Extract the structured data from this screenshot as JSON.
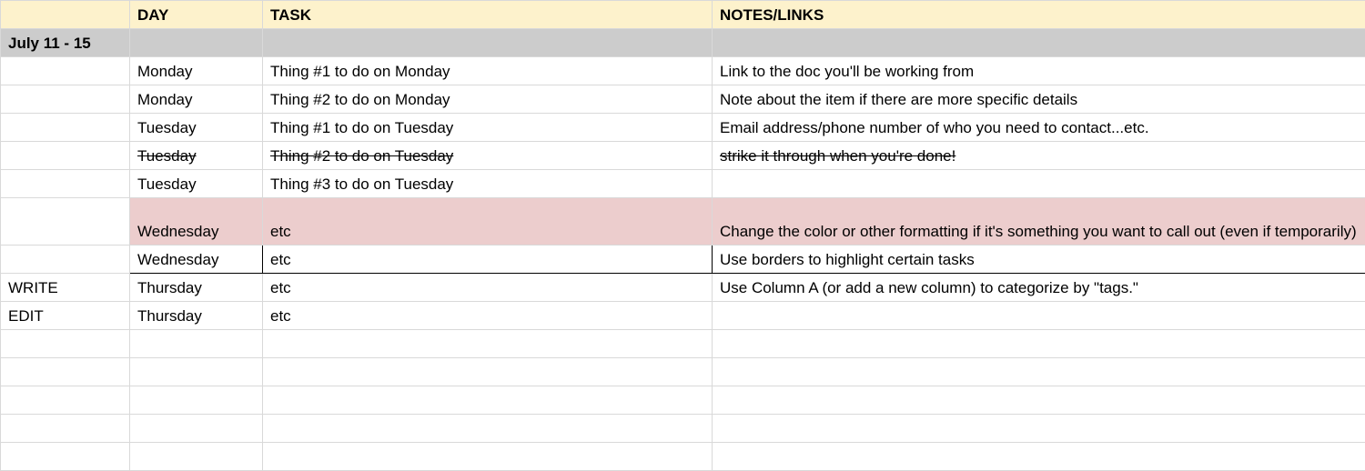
{
  "headers": {
    "a": "",
    "day": "DAY",
    "task": "TASK",
    "notes": "NOTES/LINKS"
  },
  "week_label": "July 11 - 15",
  "rows": [
    {
      "a": "",
      "day": "Monday",
      "task": "Thing #1 to do on Monday",
      "notes": "Link to the doc you'll be working from"
    },
    {
      "a": "",
      "day": "Monday",
      "task": "Thing #2 to do on Monday",
      "notes": "Note about the item if there are more specific details"
    },
    {
      "a": "",
      "day": "Tuesday",
      "task": "Thing #1 to do on Tuesday",
      "notes": "Email address/phone number of who you need to contact...etc."
    },
    {
      "a": "",
      "day": "Tuesday",
      "task": "Thing #2 to do on Tuesday",
      "notes": "strike it through when you're done!"
    },
    {
      "a": "",
      "day": "Tuesday",
      "task": "Thing #3 to do on Tuesday",
      "notes": ""
    },
    {
      "a": "",
      "day": "Wednesday",
      "task": "etc",
      "notes": "Change the color or other formatting if it's something you want to call out (even if temporarily)"
    },
    {
      "a": "",
      "day": "Wednesday",
      "task": "etc",
      "notes": "Use borders to highlight certain tasks"
    },
    {
      "a": "WRITE",
      "day": "Thursday",
      "task": "etc",
      "notes": "Use Column A (or add a new column) to categorize by \"tags.\""
    },
    {
      "a": "EDIT",
      "day": "Thursday",
      "task": "etc",
      "notes": ""
    }
  ]
}
